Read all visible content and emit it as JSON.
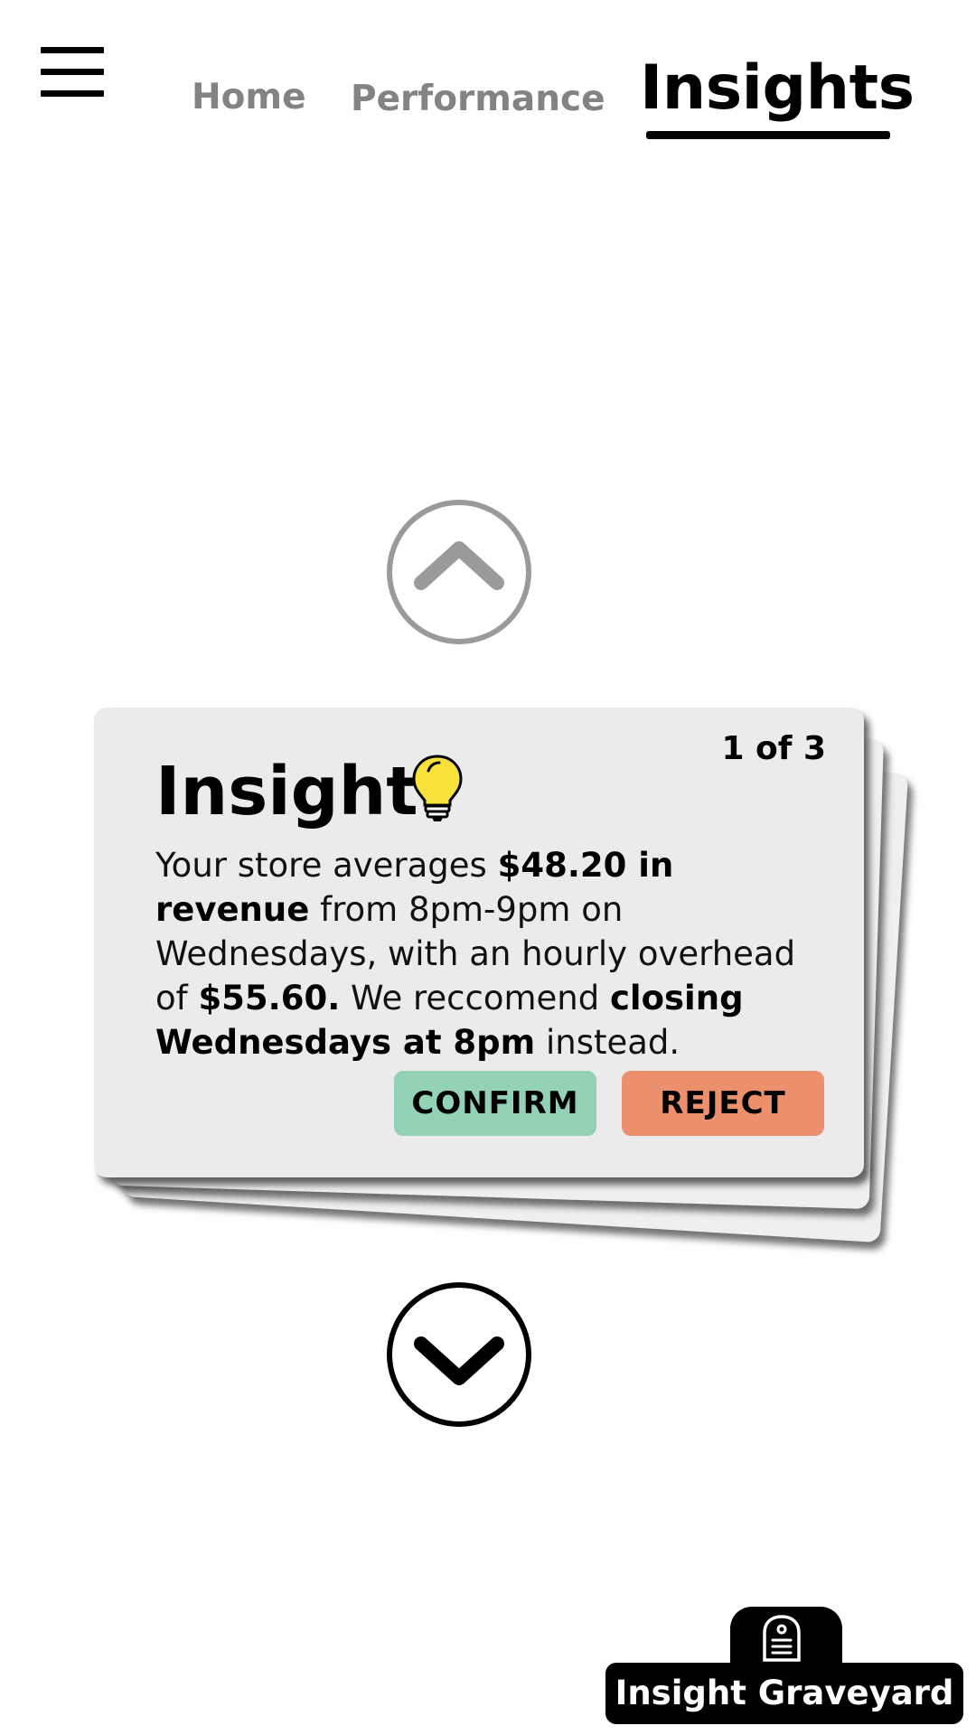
{
  "nav": {
    "tabs": [
      {
        "label": "Home"
      },
      {
        "label": "Performance"
      },
      {
        "label": "Insights"
      }
    ],
    "active_tab": "Insights",
    "menu_icon": "hamburger-menu-icon"
  },
  "insight_card": {
    "counter": "1 of 3",
    "title": "Insight",
    "title_icon": "lightbulb-icon",
    "body": {
      "t1": "Your store averages ",
      "b1": "$48.20 in revenue",
      "t2": " from 8pm-9pm on Wednesdays, with an hourly overhead of ",
      "b2": "$55.60.",
      "t3": " We reccomend ",
      "b3": "closing Wednesdays at 8pm",
      "t4": " instead."
    },
    "confirm_label": "CONFIRM",
    "reject_label": "REJECT"
  },
  "navigation_arrows": {
    "up_icon": "chevron-up-icon",
    "down_icon": "chevron-down-icon"
  },
  "graveyard": {
    "label": "Insight Graveyard",
    "icon": "tombstone-icon"
  },
  "colors": {
    "confirm": "#94d2b5",
    "reject": "#eb8f6d",
    "card_bg": "#ebebeb",
    "inactive_tab": "#838383",
    "bulb": "#f7e23a"
  }
}
